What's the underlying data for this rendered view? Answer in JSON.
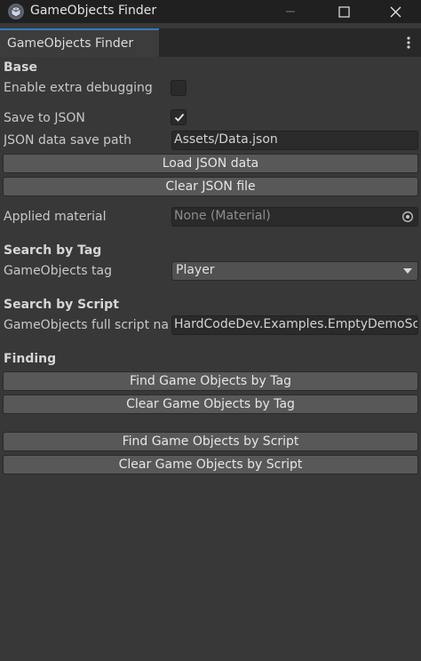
{
  "window": {
    "title": "GameObjects Finder",
    "tab_label": "GameObjects Finder"
  },
  "base": {
    "section_title": "Base",
    "enable_debugging_label": "Enable extra debugging",
    "enable_debugging_checked": false,
    "save_json_label": "Save to JSON",
    "save_json_checked": true,
    "json_path_label": "JSON data save path",
    "json_path_value": "Assets/Data.json",
    "load_json_button": "Load JSON data",
    "clear_json_button": "Clear JSON file",
    "applied_material_label": "Applied material",
    "applied_material_value": "None (Material)"
  },
  "search_by_tag": {
    "section_title": "Search by Tag",
    "tag_label": "GameObjects tag",
    "tag_selected": "Player"
  },
  "search_by_script": {
    "section_title": "Search by Script",
    "script_label": "GameObjects full script name",
    "script_value": "HardCodeDev.Examples.EmptyDemoScript"
  },
  "finding": {
    "section_title": "Finding",
    "find_by_tag_button": "Find Game Objects by Tag",
    "clear_by_tag_button": "Clear Game Objects by Tag",
    "find_by_script_button": "Find Game Objects by Script",
    "clear_by_script_button": "Clear Game Objects by Script"
  },
  "icons": {
    "app": "unity-cube-icon",
    "minimize": "minimize-icon",
    "maximize": "maximize-icon",
    "close": "close-icon",
    "tab_menu": "kebab-menu-icon",
    "object_picker": "object-picker-icon",
    "dropdown": "chevron-down-icon",
    "check": "checkmark-icon"
  },
  "colors": {
    "background": "#383838",
    "titlebar": "#202020",
    "field": "#2a2a2a",
    "button": "#585858",
    "tab_accent": "#3a79bb"
  }
}
